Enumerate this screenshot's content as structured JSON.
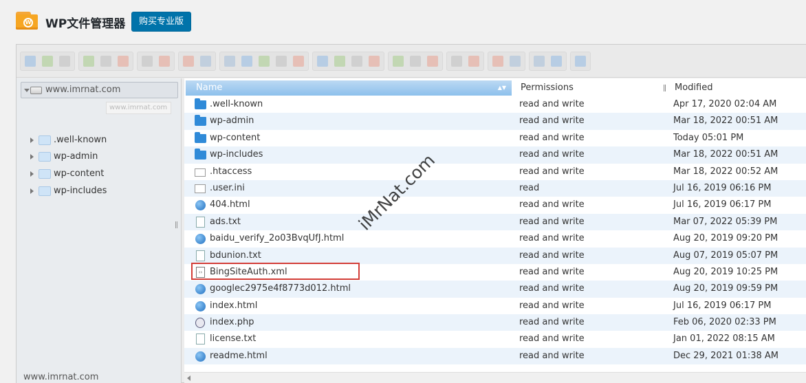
{
  "header": {
    "title": "WP文件管理器",
    "buy_button": "购买专业版"
  },
  "toolbar": {
    "groups": [
      {
        "icons": [
          "back-icon",
          "forward-icon",
          "up-icon"
        ]
      },
      {
        "icons": [
          "reload-icon",
          "new-file-icon",
          "save-icon"
        ]
      },
      {
        "icons": [
          "open-icon",
          "download-icon"
        ]
      },
      {
        "icons": [
          "undo-icon",
          "redo-icon"
        ]
      },
      {
        "icons": [
          "copy-icon",
          "cut-icon",
          "paste-icon",
          "delete-icon",
          "empty-icon"
        ]
      },
      {
        "icons": [
          "duplicate-icon",
          "rename-icon",
          "edit-icon",
          "resize-icon"
        ]
      },
      {
        "icons": [
          "grid-view-icon",
          "list-view-icon",
          "thumbnail-icon"
        ]
      },
      {
        "icons": [
          "preview-icon",
          "info-icon"
        ]
      },
      {
        "icons": [
          "extract-icon",
          "archive-icon"
        ]
      },
      {
        "icons": [
          "select-all-icon",
          "help-icon"
        ]
      },
      {
        "icons": [
          "fullscreen-icon"
        ]
      }
    ]
  },
  "tree": {
    "root": "www.imrnat.com",
    "ghost": "www.imrnat.com",
    "items": [
      {
        "label": ".well-known"
      },
      {
        "label": "wp-admin"
      },
      {
        "label": "wp-content"
      },
      {
        "label": "wp-includes"
      }
    ]
  },
  "columns": {
    "name": "Name",
    "permissions": "Permissions",
    "modified": "Modified"
  },
  "files": [
    {
      "name": ".well-known",
      "icon": "folder-icon",
      "perm": "read and write",
      "modified": "Apr 17, 2020 02:04 AM"
    },
    {
      "name": "wp-admin",
      "icon": "folder-icon",
      "perm": "read and write",
      "modified": "Mar 18, 2022 00:51 AM"
    },
    {
      "name": "wp-content",
      "icon": "folder-icon",
      "perm": "read and write",
      "modified": "Today 05:01 PM"
    },
    {
      "name": "wp-includes",
      "icon": "folder-icon",
      "perm": "read and write",
      "modified": "Mar 18, 2022 00:51 AM"
    },
    {
      "name": ".htaccess",
      "icon": "blank-file-icon",
      "perm": "read and write",
      "modified": "Mar 18, 2022 00:52 AM"
    },
    {
      "name": ".user.ini",
      "icon": "ini-file-icon",
      "perm": "read",
      "modified": "Jul 16, 2019 06:16 PM"
    },
    {
      "name": "404.html",
      "icon": "html-file-icon",
      "perm": "read and write",
      "modified": "Jul 16, 2019 06:17 PM"
    },
    {
      "name": "ads.txt",
      "icon": "text-file-icon",
      "perm": "read and write",
      "modified": "Mar 07, 2022 05:39 PM"
    },
    {
      "name": "baidu_verify_2o03BvqUfJ.html",
      "icon": "html-file-icon",
      "perm": "read and write",
      "modified": "Aug 20, 2019 09:20 PM"
    },
    {
      "name": "bdunion.txt",
      "icon": "text-file-icon",
      "perm": "read and write",
      "modified": "Aug 07, 2019 05:07 PM"
    },
    {
      "name": "BingSiteAuth.xml",
      "icon": "xml-file-icon",
      "perm": "read and write",
      "modified": "Aug 20, 2019 10:25 PM"
    },
    {
      "name": "googlec2975e4f8773d012.html",
      "icon": "html-file-icon",
      "perm": "read and write",
      "modified": "Aug 20, 2019 09:59 PM"
    },
    {
      "name": "index.html",
      "icon": "html-file-icon",
      "perm": "read and write",
      "modified": "Jul 16, 2019 06:17 PM"
    },
    {
      "name": "index.php",
      "icon": "php-file-icon",
      "perm": "read and write",
      "modified": "Feb 06, 2020 02:33 PM"
    },
    {
      "name": "license.txt",
      "icon": "text-file-icon",
      "perm": "read and write",
      "modified": "Jan 01, 2022 08:15 AM"
    },
    {
      "name": "readme.html",
      "icon": "html-file-icon",
      "perm": "read and write",
      "modified": "Dec 29, 2021 01:38 AM"
    }
  ],
  "status_bar": "www.imrnat.com",
  "watermark": "iMrNat.com",
  "colors": {
    "accent": "#0073aa",
    "header_row": "#8dc0ec",
    "alt_row": "#ebf3fb",
    "highlight": "#d23c36",
    "folder": "#2f8ad8"
  }
}
